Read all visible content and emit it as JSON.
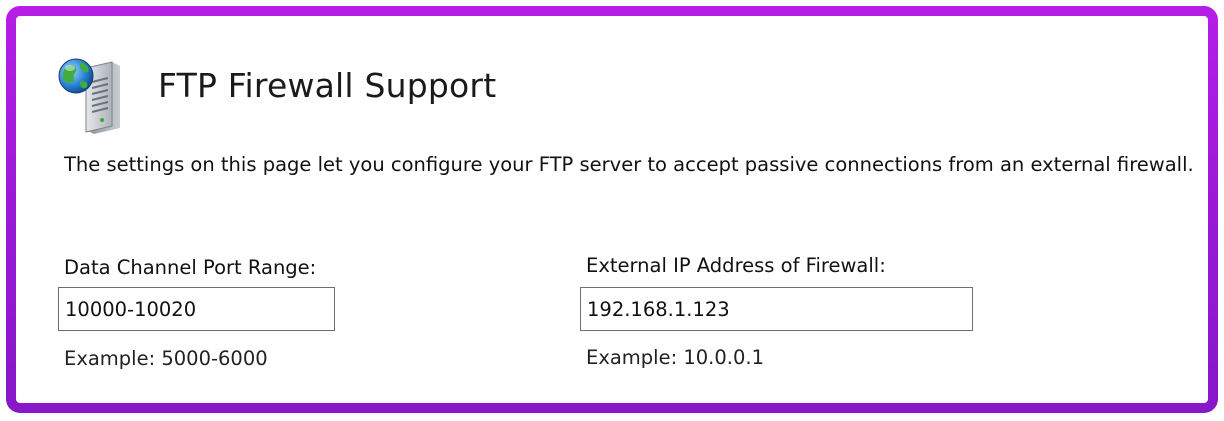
{
  "header": {
    "title": "FTP Firewall Support",
    "icon": "ftp-server-globe-icon"
  },
  "description": "The settings on this page let you configure your FTP server to accept passive connections from an external firewall.",
  "fields": {
    "port_range": {
      "label": "Data Channel Port Range:",
      "value": "10000-10020",
      "example": "Example: 5000-6000"
    },
    "external_ip": {
      "label": "External IP Address of Firewall:",
      "value": "192.168.1.123",
      "example": "Example: 10.0.0.1"
    }
  },
  "colors": {
    "frame_accent": "#a01ad9",
    "input_border": "#6e6e6e"
  }
}
